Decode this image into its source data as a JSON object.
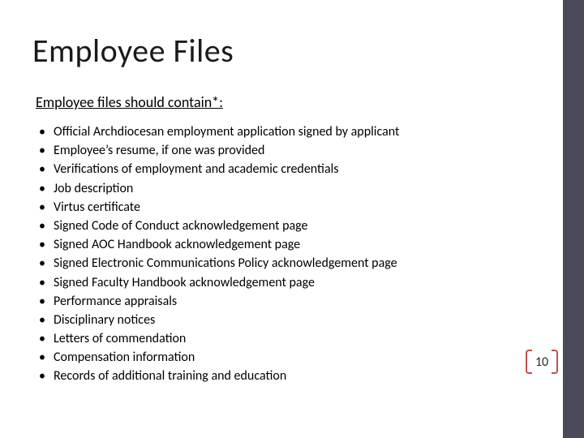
{
  "title": "Employee Files",
  "subtitle": "Employee files should contain*:",
  "bullets": [
    "Official Archdiocesan employment application signed by applicant",
    "Employee’s resume, if one was provided",
    "Verifications of employment and academic credentials",
    "Job description",
    "Virtus certificate",
    "Signed Code of Conduct acknowledgement page",
    "Signed AOC Handbook acknowledgement page",
    "Signed Electronic Communications Policy acknowledgement page",
    "Signed Faculty Handbook  acknowledgement page",
    "Performance appraisals",
    "Disciplinary notices",
    "Letters of commendation",
    "Compensation information",
    "Records of additional training and education"
  ],
  "page_number": "10",
  "accent_color": "#c0504d",
  "sidebar_color": "#4a4b5a"
}
